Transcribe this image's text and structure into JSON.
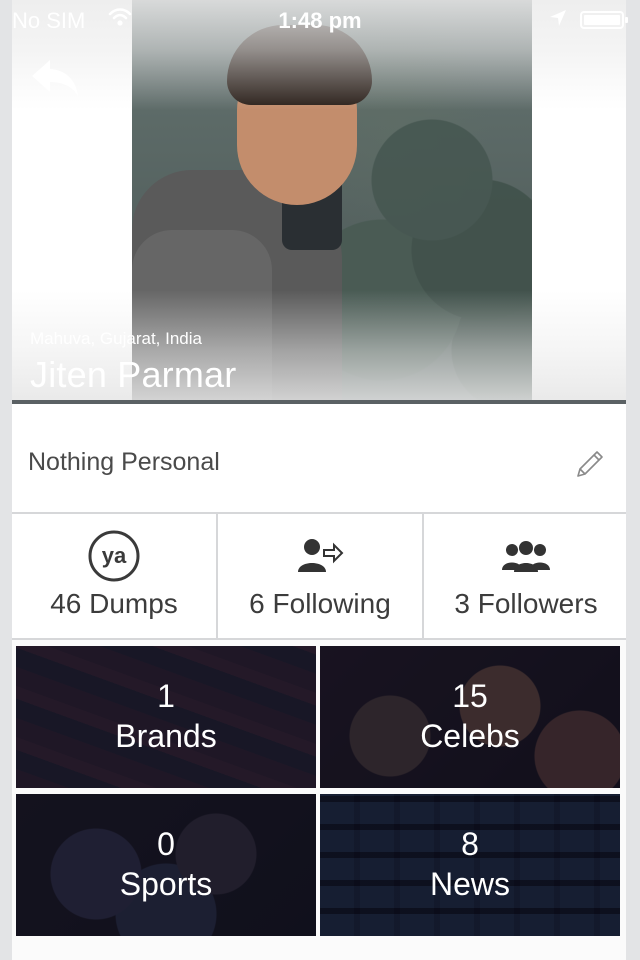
{
  "status_bar": {
    "carrier": "No SIM",
    "time": "1:48 pm"
  },
  "profile": {
    "location": "Mahuva, Gujarat, India",
    "name": "Jiten Parmar",
    "status_text": "Nothing Personal"
  },
  "stats": [
    {
      "label": "46 Dumps",
      "icon": "ya-logo-icon"
    },
    {
      "label": "6 Following",
      "icon": "following-icon"
    },
    {
      "label": "3 Followers",
      "icon": "followers-icon"
    }
  ],
  "categories": [
    {
      "count": "1",
      "title": "Brands"
    },
    {
      "count": "15",
      "title": "Celebs"
    },
    {
      "count": "0",
      "title": "Sports"
    },
    {
      "count": "8",
      "title": "News"
    }
  ]
}
